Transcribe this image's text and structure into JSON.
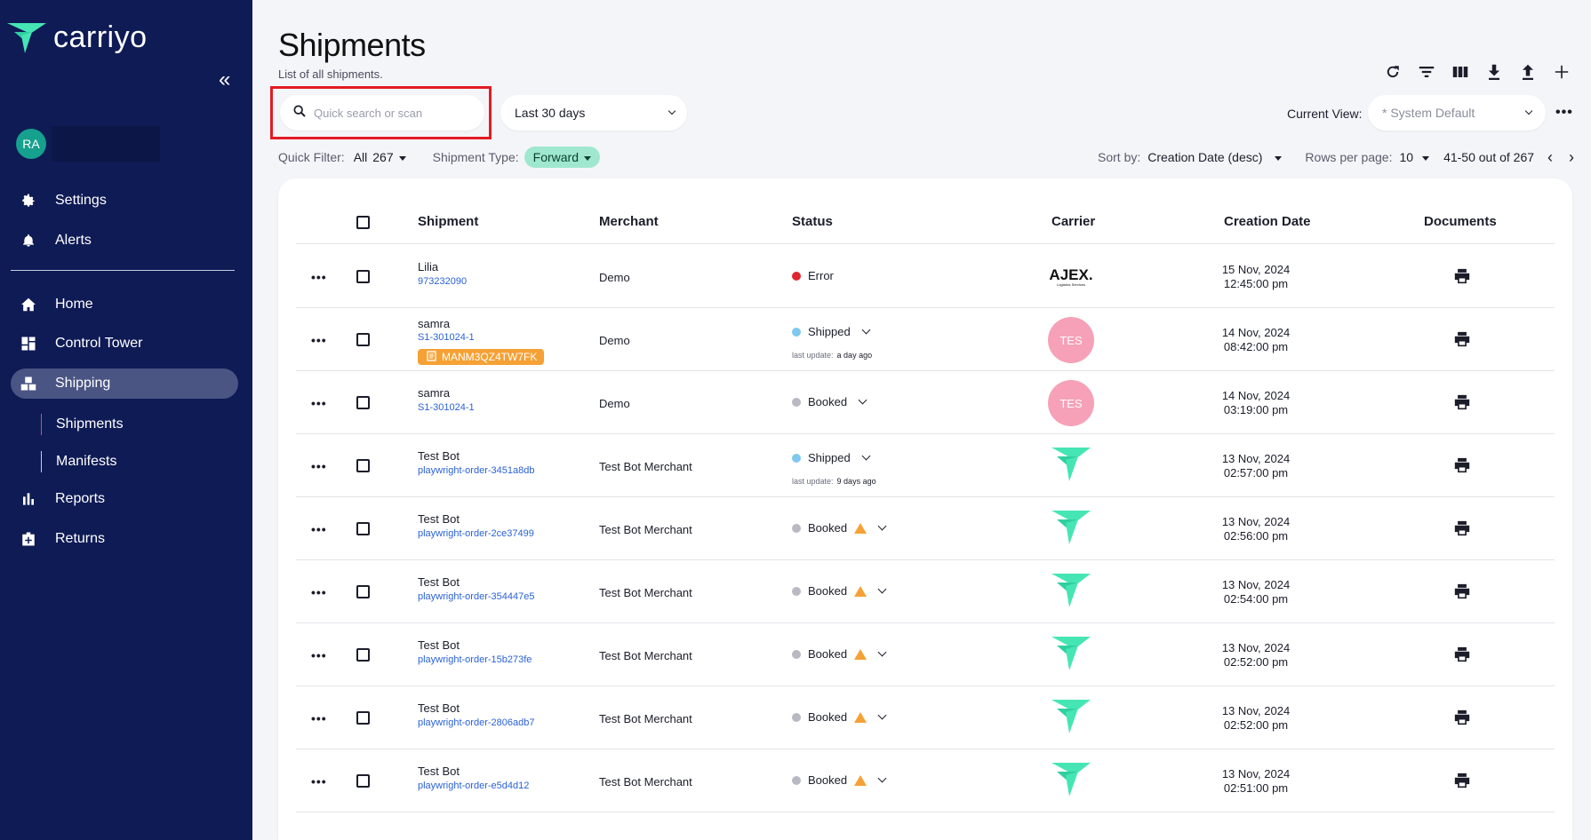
{
  "brand": {
    "name": "carriyo",
    "accent": "#45e6b4"
  },
  "user": {
    "initials": "RA"
  },
  "sidebar": {
    "items": [
      {
        "label": "Settings",
        "icon": "gear-icon"
      },
      {
        "label": "Alerts",
        "icon": "bell-icon"
      },
      {
        "label": "Home",
        "icon": "home-icon"
      },
      {
        "label": "Control Tower",
        "icon": "dashboard-icon"
      },
      {
        "label": "Shipping",
        "icon": "shipping-icon"
      },
      {
        "label": "Reports",
        "icon": "bar-chart-icon"
      },
      {
        "label": "Returns",
        "icon": "returns-icon"
      }
    ],
    "sub_items": [
      {
        "label": "Shipments"
      },
      {
        "label": "Manifests"
      }
    ]
  },
  "page": {
    "title": "Shipments",
    "subtitle": "List of all shipments."
  },
  "search": {
    "placeholder": "Quick search or scan"
  },
  "date_range": {
    "value": "Last 30 days"
  },
  "view": {
    "label": "Current View:",
    "value": "* System Default"
  },
  "filters": {
    "quick_filter_label": "Quick Filter:",
    "quick_filter_value": "All",
    "quick_filter_count": "267",
    "shipment_type_label": "Shipment Type:",
    "shipment_type_value": "Forward"
  },
  "sort": {
    "label": "Sort by:",
    "value": "Creation Date (desc)",
    "rows_label": "Rows per page:",
    "rows_value": "10",
    "range": "41-50 out of 267"
  },
  "table": {
    "columns": [
      "Shipment",
      "Merchant",
      "Status",
      "Carrier",
      "Creation Date",
      "Documents"
    ],
    "rows": [
      {
        "name": "Lilia",
        "ref": "973232090",
        "tag": "",
        "merchant": "Demo",
        "status": "Error",
        "status_color": "#e0242f",
        "last_update": "",
        "carrier": "AJEX.",
        "carrier_sub": "Logistics Services",
        "date": "15 Nov, 2024",
        "time": "12:45:00 pm"
      },
      {
        "name": "samra",
        "ref": "S1-301024-1",
        "tag": "MANM3QZ4TW7FK",
        "merchant": "Demo",
        "status": "Shipped",
        "status_color": "#7fc8f0",
        "last_update": "a day ago",
        "carrier": "TES",
        "carrier_sub": "",
        "date": "14 Nov, 2024",
        "time": "08:42:00 pm"
      },
      {
        "name": "samra",
        "ref": "S1-301024-1",
        "tag": "",
        "merchant": "Demo",
        "status": "Booked",
        "status_color": "#b8b9c2",
        "last_update": "",
        "carrier": "TES",
        "carrier_sub": "",
        "date": "14 Nov, 2024",
        "time": "03:19:00 pm"
      },
      {
        "name": "Test Bot",
        "ref": "playwright-order-3451a8db",
        "tag": "",
        "merchant": "Test Bot Merchant",
        "status": "Shipped",
        "status_color": "#7fc8f0",
        "last_update": "9 days ago",
        "carrier": "carriyo",
        "carrier_sub": "",
        "date": "13 Nov, 2024",
        "time": "02:57:00 pm"
      },
      {
        "name": "Test Bot",
        "ref": "playwright-order-2ce37499",
        "tag": "",
        "merchant": "Test Bot Merchant",
        "status": "Booked",
        "status_color": "#b8b9c2",
        "last_update": "",
        "warning": true,
        "carrier": "carriyo",
        "carrier_sub": "",
        "date": "13 Nov, 2024",
        "time": "02:56:00 pm"
      },
      {
        "name": "Test Bot",
        "ref": "playwright-order-354447e5",
        "tag": "",
        "merchant": "Test Bot Merchant",
        "status": "Booked",
        "status_color": "#b8b9c2",
        "last_update": "",
        "warning": true,
        "carrier": "carriyo",
        "carrier_sub": "",
        "date": "13 Nov, 2024",
        "time": "02:54:00 pm"
      },
      {
        "name": "Test Bot",
        "ref": "playwright-order-15b273fe",
        "tag": "",
        "merchant": "Test Bot Merchant",
        "status": "Booked",
        "status_color": "#b8b9c2",
        "last_update": "",
        "warning": true,
        "carrier": "carriyo",
        "carrier_sub": "",
        "date": "13 Nov, 2024",
        "time": "02:52:00 pm"
      },
      {
        "name": "Test Bot",
        "ref": "playwright-order-2806adb7",
        "tag": "",
        "merchant": "Test Bot Merchant",
        "status": "Booked",
        "status_color": "#b8b9c2",
        "last_update": "",
        "warning": true,
        "carrier": "carriyo",
        "carrier_sub": "",
        "date": "13 Nov, 2024",
        "time": "02:52:00 pm"
      },
      {
        "name": "Test Bot",
        "ref": "playwright-order-e5d4d12",
        "tag": "",
        "merchant": "Test Bot Merchant",
        "status": "Booked",
        "status_color": "#b8b9c2",
        "last_update": "",
        "warning": true,
        "carrier": "carriyo",
        "carrier_sub": "",
        "date": "13 Nov, 2024",
        "time": "02:51:00 pm"
      }
    ],
    "last_update_label": "last update:"
  }
}
